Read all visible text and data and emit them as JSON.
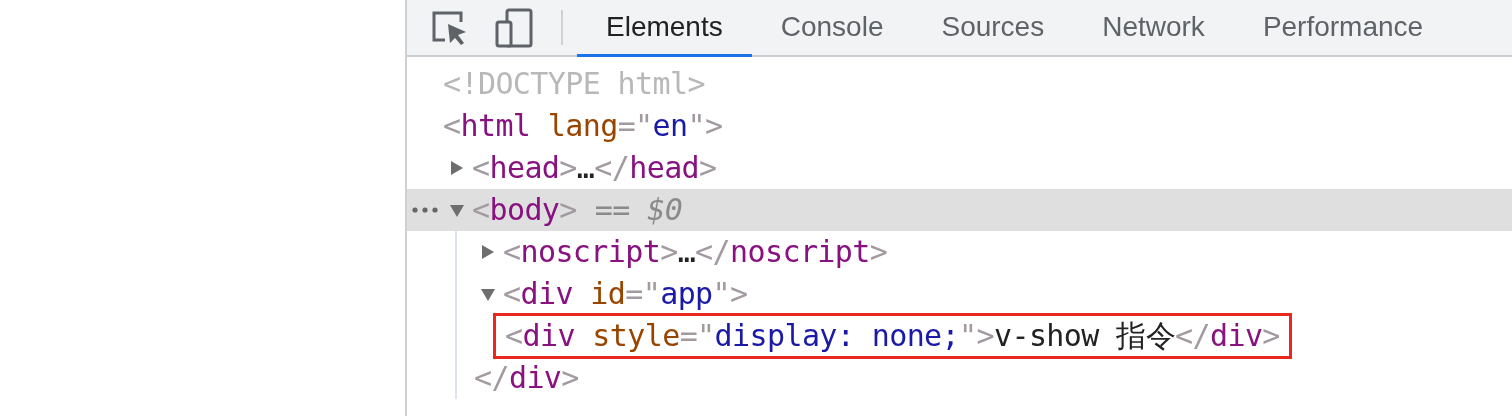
{
  "toolbar": {
    "tabs": [
      {
        "label": "Elements",
        "selected": true
      },
      {
        "label": "Console",
        "selected": false
      },
      {
        "label": "Sources",
        "selected": false
      },
      {
        "label": "Network",
        "selected": false
      },
      {
        "label": "Performance",
        "selected": false
      }
    ]
  },
  "dom_tree": [
    {
      "tokens": [
        {
          "kind": "doctype",
          "text": "<!DOCTYPE html>"
        }
      ],
      "selected": false,
      "highlighted": false
    },
    {
      "tokens": [
        {
          "kind": "punct",
          "text": "<"
        },
        {
          "kind": "tag",
          "text": "html"
        },
        {
          "kind": "attr",
          "text": " lang"
        },
        {
          "kind": "punct",
          "text": "=\""
        },
        {
          "kind": "value",
          "text": "en"
        },
        {
          "kind": "punct",
          "text": "\">"
        }
      ],
      "selected": false,
      "highlighted": false
    },
    {
      "tokens": [
        {
          "kind": "punct",
          "text": "<"
        },
        {
          "kind": "tag",
          "text": "head"
        },
        {
          "kind": "punct",
          "text": ">"
        },
        {
          "kind": "ellipsis",
          "text": "…"
        },
        {
          "kind": "punct",
          "text": "</"
        },
        {
          "kind": "tag",
          "text": "head"
        },
        {
          "kind": "punct",
          "text": ">"
        }
      ],
      "expanded": false,
      "selected": false,
      "highlighted": false
    },
    {
      "tokens": [
        {
          "kind": "punct",
          "text": "<"
        },
        {
          "kind": "tag",
          "text": "body"
        },
        {
          "kind": "punct",
          "text": ">"
        }
      ],
      "ref": "== *$0*",
      "expanded": true,
      "selected": true,
      "highlighted": false,
      "children": [
        {
          "tokens": [
            {
              "kind": "punct",
              "text": "<"
            },
            {
              "kind": "tag",
              "text": "noscript"
            },
            {
              "kind": "punct",
              "text": ">"
            },
            {
              "kind": "ellipsis",
              "text": "…"
            },
            {
              "kind": "punct",
              "text": "</"
            },
            {
              "kind": "tag",
              "text": "noscript"
            },
            {
              "kind": "punct",
              "text": ">"
            }
          ],
          "expanded": false,
          "selected": false,
          "highlighted": false
        },
        {
          "tokens": [
            {
              "kind": "punct",
              "text": "<"
            },
            {
              "kind": "tag",
              "text": "div"
            },
            {
              "kind": "attr",
              "text": " id"
            },
            {
              "kind": "punct",
              "text": "=\""
            },
            {
              "kind": "value",
              "text": "app"
            },
            {
              "kind": "punct",
              "text": "\">"
            }
          ],
          "expanded": true,
          "selected": false,
          "highlighted": false,
          "children": [
            {
              "tokens": [
                {
                  "kind": "punct",
                  "text": "<"
                },
                {
                  "kind": "tag",
                  "text": "div"
                },
                {
                  "kind": "attr",
                  "text": " style"
                },
                {
                  "kind": "punct",
                  "text": "=\""
                },
                {
                  "kind": "value",
                  "text": "display: none;"
                },
                {
                  "kind": "punct",
                  "text": "\">"
                },
                {
                  "kind": "text",
                  "text": "v-show 指令"
                },
                {
                  "kind": "punct",
                  "text": "</"
                },
                {
                  "kind": "tag",
                  "text": "div"
                },
                {
                  "kind": "punct",
                  "text": ">"
                }
              ],
              "selected": false,
              "highlighted": true
            }
          ]
        },
        {
          "tokens": [
            {
              "kind": "punct",
              "text": "</"
            },
            {
              "kind": "tag",
              "text": "div"
            },
            {
              "kind": "punct",
              "text": ">"
            }
          ],
          "selected": false,
          "highlighted": false
        }
      ]
    }
  ]
}
